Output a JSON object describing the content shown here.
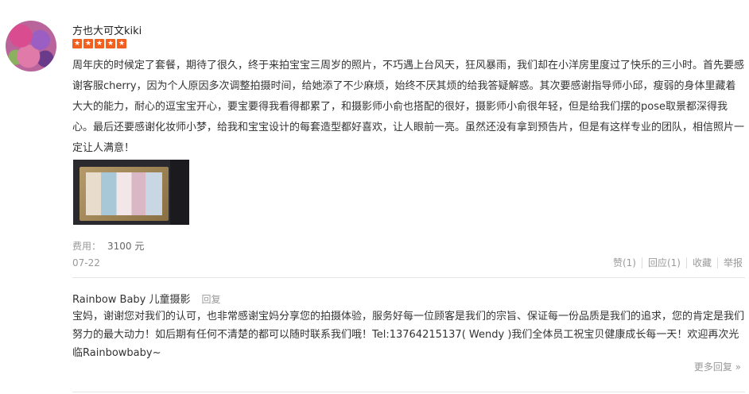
{
  "review": {
    "username": "方也大可文kiki",
    "rating": 5,
    "text": "周年庆的时候定了套餐，期待了很久，终于来拍宝宝三周岁的照片，不巧遇上台风天，狂风暴雨，我们却在小洋房里度过了快乐的三小时。首先要感谢客服cherry，因为个人原因多次调整拍摄时间，给她添了不少麻烦，始终不厌其烦的给我答疑解惑。其次要感谢指导师小邱，瘦弱的身体里藏着大大的能力，耐心的逗宝宝开心，要宝要得我看得都累了，和摄影师小俞也搭配的很好，摄影师小俞很年轻，但是给我们摆的pose取景都深得我心。最后还要感谢化妆师小梦，给我和宝宝设计的每套造型都好喜欢，让人眼前一亮。虽然还没有拿到预告片，但是有这样专业的团队，相信照片一定让人满意！",
    "cost_label": "费用：",
    "cost_value": "3100 元",
    "date": "07-22",
    "actions": {
      "like": "赞(1)",
      "reply": "回应(1)",
      "favorite": "收藏",
      "report": "举报"
    }
  },
  "merchant_reply": {
    "name": "Rainbow Baby 儿童摄影",
    "tag": "回复",
    "text": "宝妈，谢谢您对我们的认可，也非常感谢宝妈分享您的拍摄体验，服务好每一位顾客是我们的宗旨、保证每一份品质是我们的追求，您的肯定是我们努力的最大动力！如后期有任何不清楚的都可以随时联系我们哦！Tel:13764215137( Wendy )我们全体员工祝宝贝健康成长每一天！欢迎再次光临Rainbowbaby~",
    "more": "更多回复 »"
  },
  "colors": {
    "star": "#f25f1f",
    "muted": "#999999",
    "text": "#333333"
  }
}
